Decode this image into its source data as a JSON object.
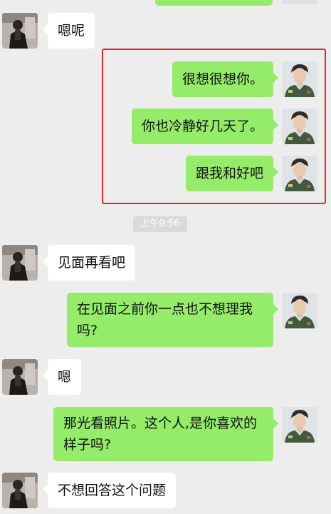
{
  "messages": [
    {
      "side": "left",
      "text": "嗯呢"
    },
    {
      "side": "right",
      "text": "很想很想你。"
    },
    {
      "side": "right",
      "text": "你也冷静好几天了。"
    },
    {
      "side": "right",
      "text": "跟我和好吧"
    },
    {
      "side": "left",
      "text": "见面再看吧"
    },
    {
      "side": "right",
      "text": "在见面之前你一点也不想理我吗?"
    },
    {
      "side": "left",
      "text": "嗯"
    },
    {
      "side": "right",
      "text": "那光看照片。这个人,是你喜欢的样子吗?"
    },
    {
      "side": "left",
      "text": "不想回答这个问题"
    }
  ],
  "timestamp": "上午9:56",
  "colors": {
    "background": "#ededed",
    "sent_bubble": "#95ec69",
    "received_bubble": "#ffffff",
    "highlight_border": "#e02a2a"
  },
  "icons": {
    "left_avatar": "person-in-dark-suit-avatar",
    "right_avatar": "illustrated-man-avatar"
  }
}
